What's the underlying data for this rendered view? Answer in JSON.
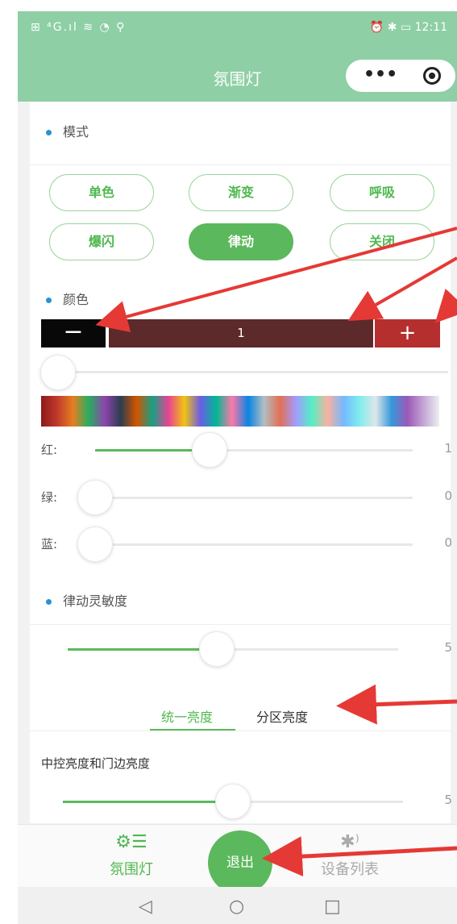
{
  "status_bar": {
    "left": "⊞ ⁴G.ıl ≋ ◔ ⚲",
    "right": "⏰ ✱ ▭ 12:11"
  },
  "header": {
    "title": "氛围灯",
    "menu_dots": "•••"
  },
  "mode_section": {
    "title": "模式",
    "buttons": [
      {
        "label": "单色",
        "active": false
      },
      {
        "label": "渐变",
        "active": false
      },
      {
        "label": "呼吸",
        "active": false
      },
      {
        "label": "爆闪",
        "active": false
      },
      {
        "label": "律动",
        "active": true
      },
      {
        "label": "关闭",
        "active": false
      }
    ]
  },
  "color_section": {
    "title": "颜色",
    "stepper": {
      "minus": "−",
      "value": "1",
      "plus": "+"
    },
    "sliders": [
      {
        "label": "红:",
        "value": "1",
        "level": 0.36
      },
      {
        "label": "绿:",
        "value": "0",
        "level": 0.0
      },
      {
        "label": "蓝:",
        "value": "0",
        "level": 0.0
      }
    ]
  },
  "rhythm_section": {
    "title": "律动灵敏度",
    "value": "5",
    "level": 0.45
  },
  "brightness_tabs": {
    "tabs": [
      "统一亮度",
      "分区亮度"
    ],
    "active_index": 0
  },
  "brightness": {
    "label": "中控亮度和门边亮度",
    "value": "5",
    "level": 0.5
  },
  "tabbar": {
    "ambient_label": "氛围灯",
    "exit_label": "退出",
    "devices_label": "设备列表"
  },
  "colors": {
    "brand_green": "#5cb85c",
    "header_green": "#8ecfa5",
    "accent_blue": "#2d8fd4",
    "arrow_red": "#e53935"
  }
}
